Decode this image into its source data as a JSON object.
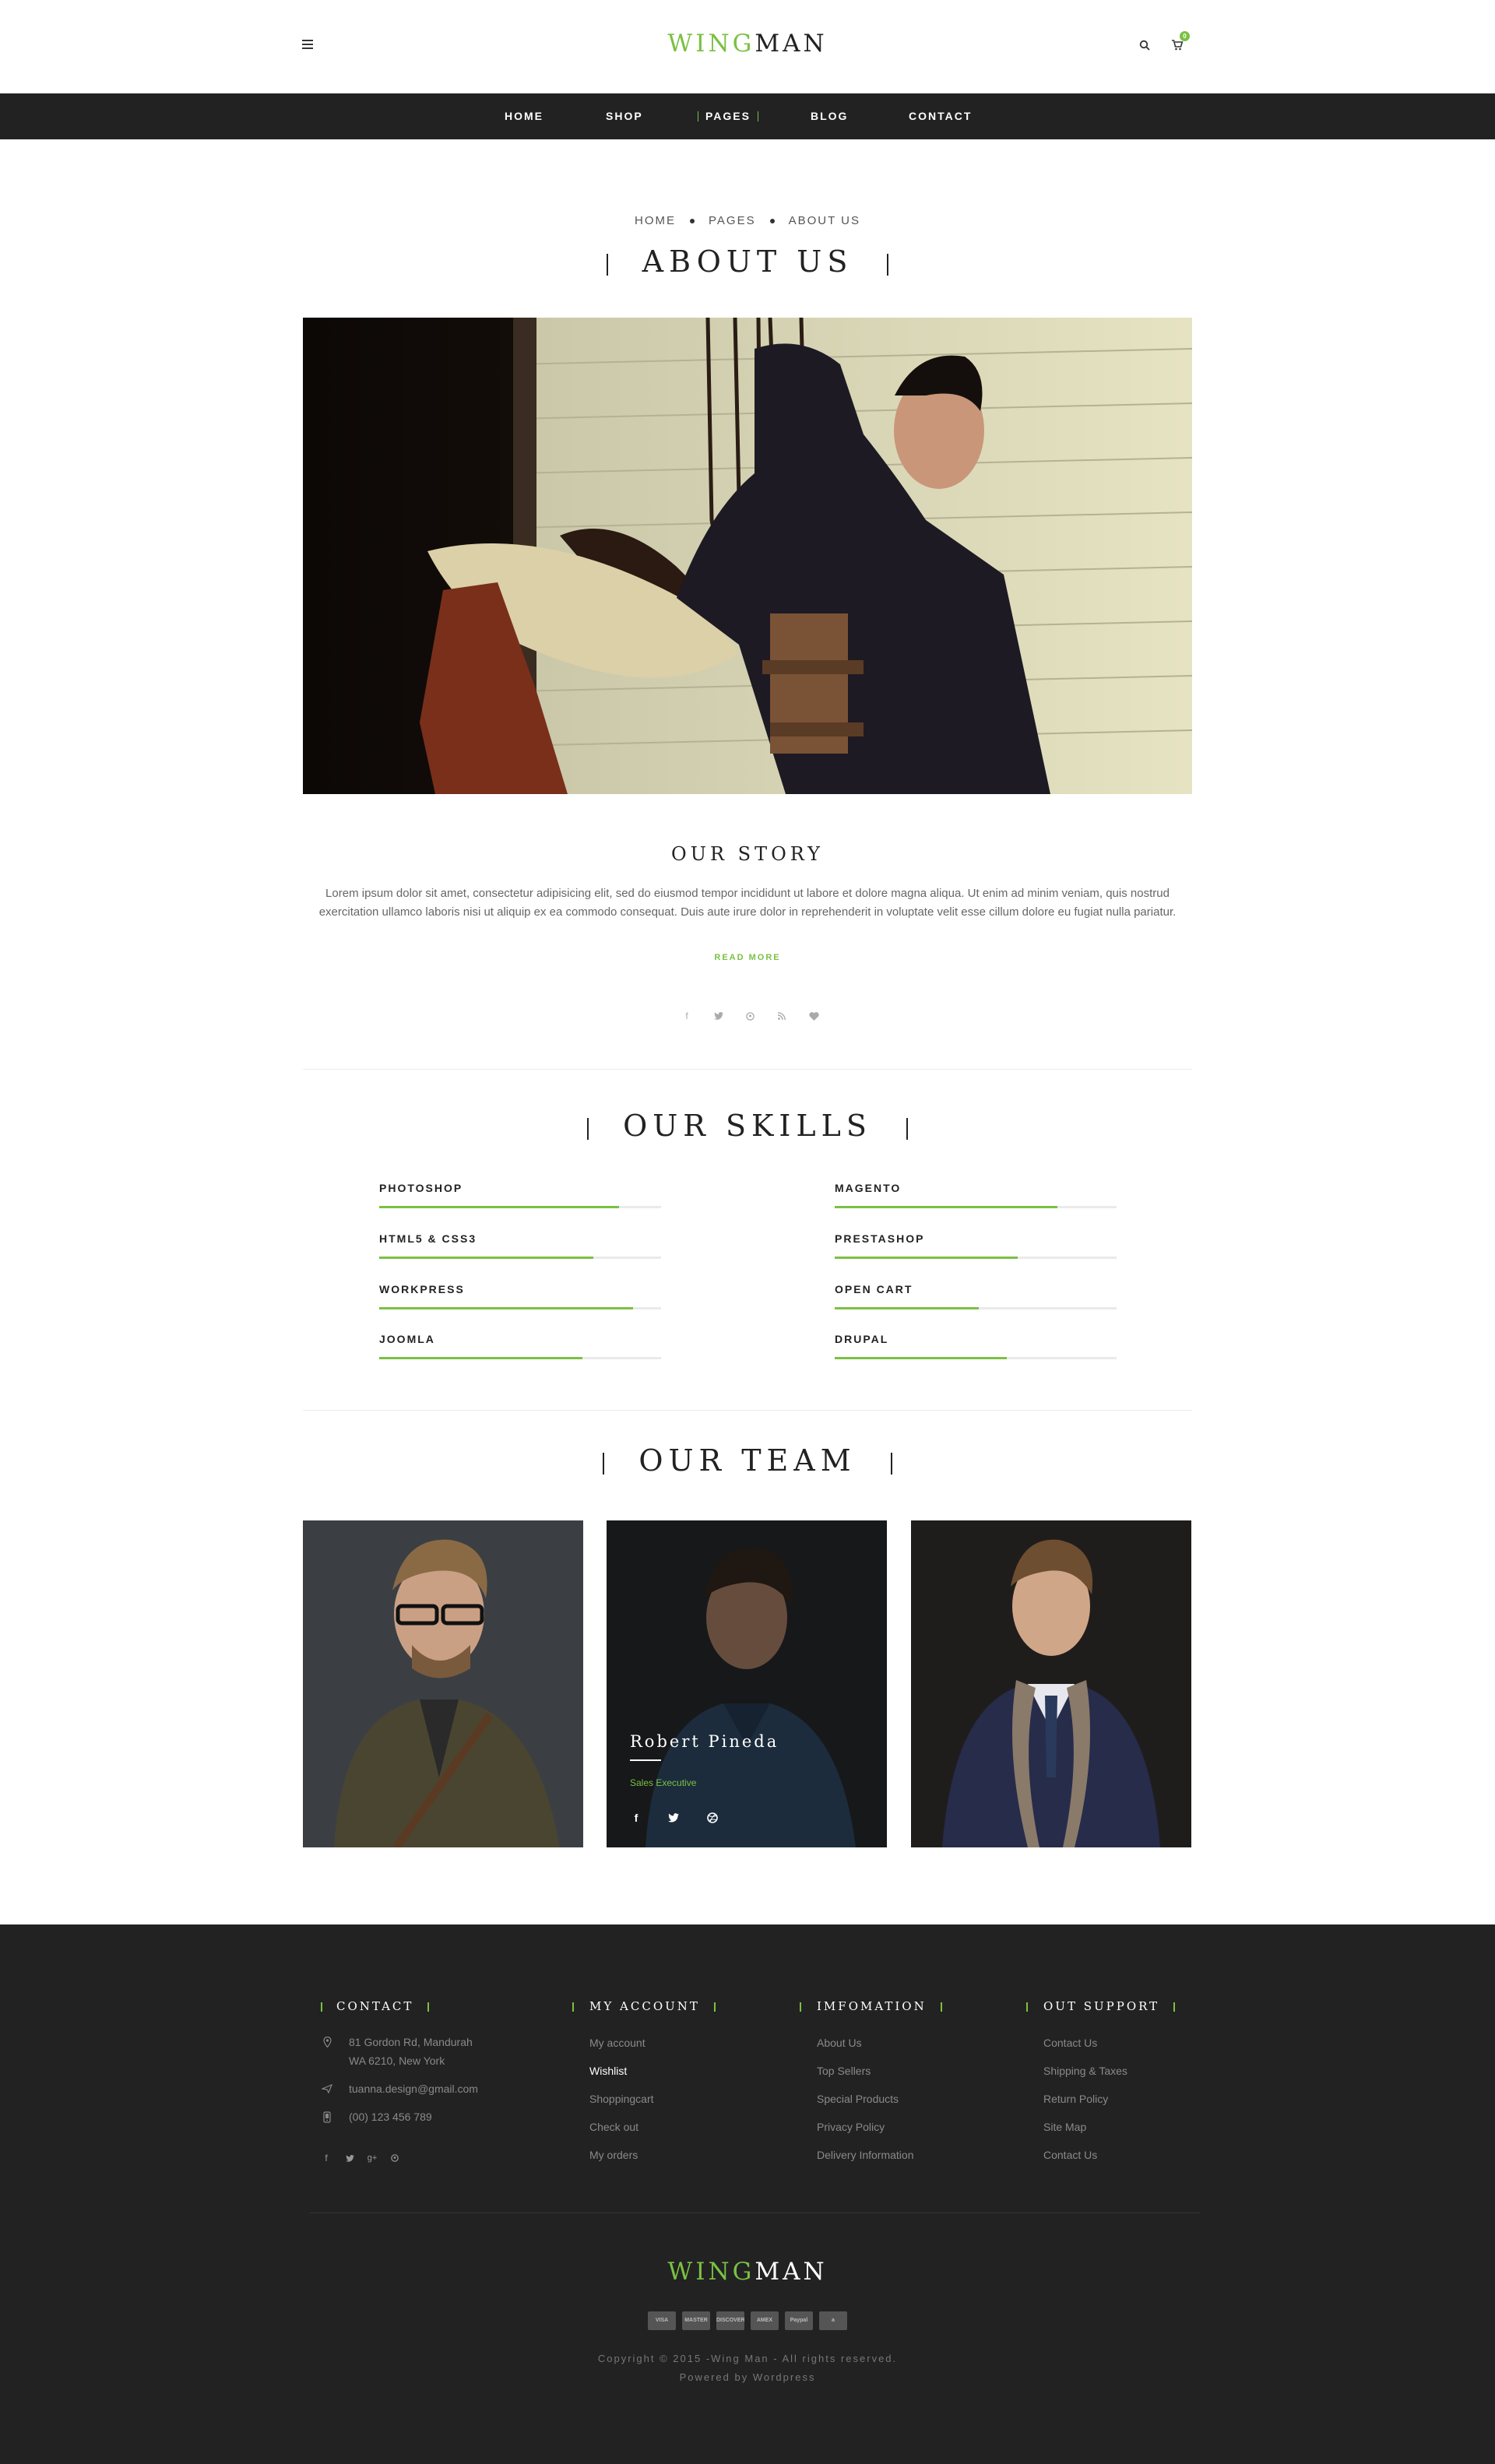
{
  "header": {
    "logo_part1": "WING",
    "logo_part2": "MAN",
    "cart_count": "0"
  },
  "nav": {
    "items": [
      "HOME",
      "SHOP",
      "PAGES",
      "BLOG",
      "CONTACT"
    ],
    "active": "PAGES"
  },
  "breadcrumb": {
    "items": [
      "HOME",
      "PAGES",
      "ABOUT US"
    ]
  },
  "page_title": "ABOUT US",
  "story": {
    "title": "OUR STORY",
    "text": "Lorem ipsum dolor sit amet, consectetur adipisicing elit, sed do eiusmod tempor incididunt ut labore et dolore magna aliqua. Ut enim ad minim veniam, quis nostrud exercitation ullamco laboris nisi ut aliquip ex ea commodo consequat. Duis aute irure dolor in reprehenderit in voluptate velit esse cillum dolore eu fugiat nulla pariatur.",
    "read_more": "READ MORE",
    "social_icons": [
      "facebook-icon",
      "twitter-icon",
      "pinterest-icon",
      "rss-icon",
      "heart-icon"
    ]
  },
  "skills": {
    "title": "OUR SKILLS",
    "items": [
      {
        "name": "PHOTOSHOP",
        "percent": 85
      },
      {
        "name": "MAGENTO",
        "percent": 79
      },
      {
        "name": "HTML5 & CSS3",
        "percent": 76
      },
      {
        "name": "PRESTASHOP",
        "percent": 65
      },
      {
        "name": "WORKPRESS",
        "percent": 90
      },
      {
        "name": "OPEN CART",
        "percent": 51
      },
      {
        "name": "JOOMLA",
        "percent": 72
      },
      {
        "name": "DRUPAL",
        "percent": 61
      }
    ]
  },
  "team": {
    "title": "OUR TEAM",
    "featured": {
      "name": "Robert Pineda",
      "role": "Sales Executive",
      "social_icons": [
        "facebook-icon",
        "twitter-icon",
        "dribbble-icon"
      ]
    }
  },
  "footer": {
    "contact": {
      "title": "CONTACT",
      "address_line1": "81 Gordon Rd, Mandurah",
      "address_line2": "WA 6210, New York",
      "email": "tuanna.design@gmail.com",
      "phone": "(00) 123 456 789",
      "social_icons": [
        "facebook-icon",
        "twitter-icon",
        "google-plus-icon",
        "pinterest-icon"
      ]
    },
    "account": {
      "title": "MY ACCOUNT",
      "links": [
        "My account",
        "Wishlist",
        "Shoppingcart",
        "Check out",
        "My orders"
      ],
      "highlight": "Wishlist"
    },
    "information": {
      "title": "IMFOMATION",
      "links": [
        "About Us",
        "Top Sellers",
        "Special Products",
        "Privacy Policy",
        "Delivery Information"
      ]
    },
    "support": {
      "title": "OUT SUPPORT",
      "links": [
        "Contact Us",
        "Shipping & Taxes",
        "Return Policy",
        "Site Map",
        "Contact Us"
      ]
    },
    "logo_part1": "WING",
    "logo_part2": "MAN",
    "payments": [
      "VISA",
      "MASTER CARD",
      "DISCOVER",
      "AMEX",
      "Paypal",
      "a"
    ],
    "copyright": "Copyright © 2015 -Wing Man - All rights reserved.",
    "powered": "Powered by Wordpress"
  },
  "colors": {
    "accent": "#7ac143",
    "dark": "#222222"
  }
}
